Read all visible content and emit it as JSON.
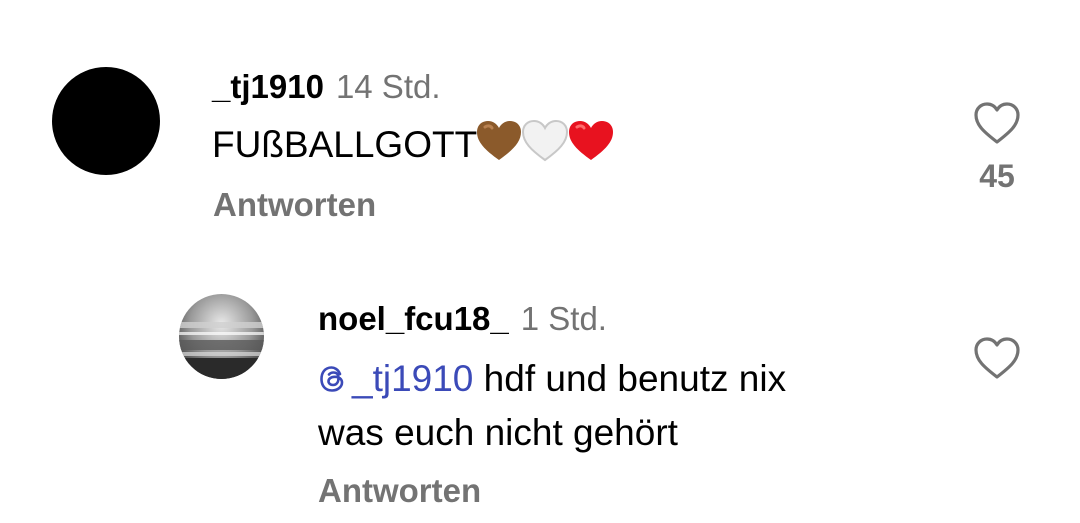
{
  "comments": [
    {
      "username": "_tj1910",
      "timestamp": "14 Std.",
      "text": "FUßBALLGOTT",
      "emojis": [
        "brown-heart",
        "white-heart",
        "red-heart"
      ],
      "reply_label": "Antworten",
      "like_count": "45",
      "like_icon": "heart-outline-icon"
    },
    {
      "username": "noel_fcu18_",
      "timestamp": "1 Std.",
      "mention": "_tj1910",
      "text_line1": "hdf und benutz nix",
      "text_line2": "was euch nicht gehört",
      "reply_label": "Antworten",
      "like_icon": "heart-outline-icon"
    }
  ],
  "colors": {
    "secondary_text": "#737373",
    "mention": "#3b4ab8",
    "brown_heart": "#8b5a2b",
    "red_heart": "#e8121f"
  }
}
